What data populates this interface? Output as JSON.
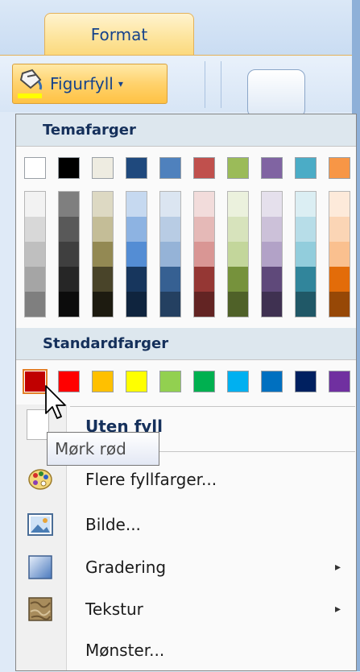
{
  "ribbon": {
    "tab_label": "Format",
    "fill_button_label": "Figurfyll",
    "fill_caret": "▾"
  },
  "menu": {
    "theme_colors_header": "Temafarger",
    "standard_colors_header": "Standardfarger",
    "theme_colors": [
      "#ffffff",
      "#000000",
      "#eeece1",
      "#1f497d",
      "#4f81bd",
      "#c0504d",
      "#9bbb59",
      "#8064a2",
      "#4bacc6",
      "#f79646"
    ],
    "theme_tints": [
      [
        "#f2f2f2",
        "#d8d8d8",
        "#bfbfbf",
        "#a5a5a5",
        "#7f7f7f"
      ],
      [
        "#7f7f7f",
        "#595959",
        "#3f3f3f",
        "#262626",
        "#0c0c0c"
      ],
      [
        "#ddd9c3",
        "#c4bd97",
        "#938953",
        "#494429",
        "#1d1b10"
      ],
      [
        "#c6d9f0",
        "#8db3e2",
        "#548dd4",
        "#17365d",
        "#0f243e"
      ],
      [
        "#dbe5f1",
        "#b8cce4",
        "#95b3d7",
        "#366092",
        "#244061"
      ],
      [
        "#f2dcdb",
        "#e5b9b7",
        "#d99694",
        "#953734",
        "#632423"
      ],
      [
        "#ebf1dd",
        "#d7e3bc",
        "#c3d69b",
        "#76923c",
        "#4f6128"
      ],
      [
        "#e5e0ec",
        "#ccc1d9",
        "#b2a2c7",
        "#5f497a",
        "#3f3151"
      ],
      [
        "#dbeef3",
        "#b7dde8",
        "#92cddc",
        "#31859b",
        "#205867"
      ],
      [
        "#fdeada",
        "#fbd5b5",
        "#fac08f",
        "#e36c09",
        "#974806"
      ]
    ],
    "standard_colors": [
      "#c00000",
      "#ff0000",
      "#ffc000",
      "#ffff00",
      "#92d050",
      "#00b050",
      "#00b0f0",
      "#0070c0",
      "#002060",
      "#7030a0"
    ],
    "no_fill_label": "Uten fyll",
    "items": [
      {
        "label": "Flere fyllfarger...",
        "icon": "color-palette-icon"
      },
      {
        "label": "Bilde...",
        "icon": "picture-icon"
      },
      {
        "label": "Gradering",
        "icon": "gradient-icon",
        "submenu": "▸"
      },
      {
        "label": "Tekstur",
        "icon": "texture-icon",
        "submenu": "▸"
      },
      {
        "label": "Mønster...",
        "icon": ""
      }
    ]
  },
  "tooltip": {
    "text": "Mørk rød"
  }
}
